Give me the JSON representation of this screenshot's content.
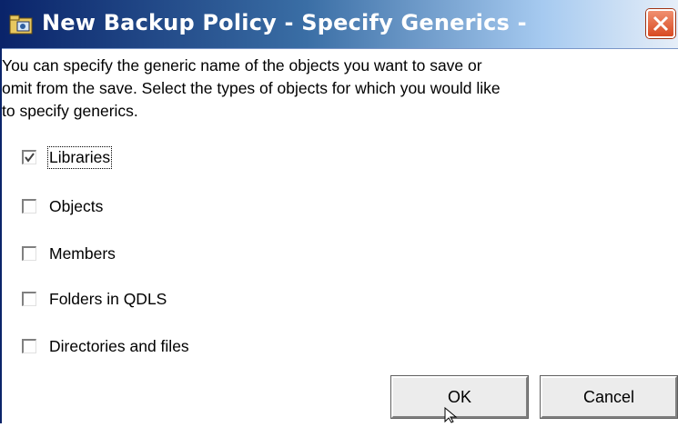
{
  "window": {
    "title": "New Backup Policy - Specify Generics -",
    "title_icon": "folder-icon",
    "close_icon": "close-icon"
  },
  "description": "You can specify the generic name of the objects you want to save or\nomit from the save.  Select the types of objects for which you would like\nto specify generics.",
  "options": [
    {
      "label": "Libraries",
      "checked": true,
      "focused": true
    },
    {
      "label": "Objects",
      "checked": false
    },
    {
      "label": "Members",
      "checked": false
    },
    {
      "label": "Folders in QDLS",
      "checked": false
    },
    {
      "label": "Directories and files",
      "checked": false
    }
  ],
  "buttons": {
    "ok_label": "OK",
    "cancel_label": "Cancel"
  },
  "colors": {
    "titlebar_start": "#0a246a",
    "titlebar_end": "#e6eef8",
    "close_button": "#d84a22",
    "background": "#ffffff"
  }
}
